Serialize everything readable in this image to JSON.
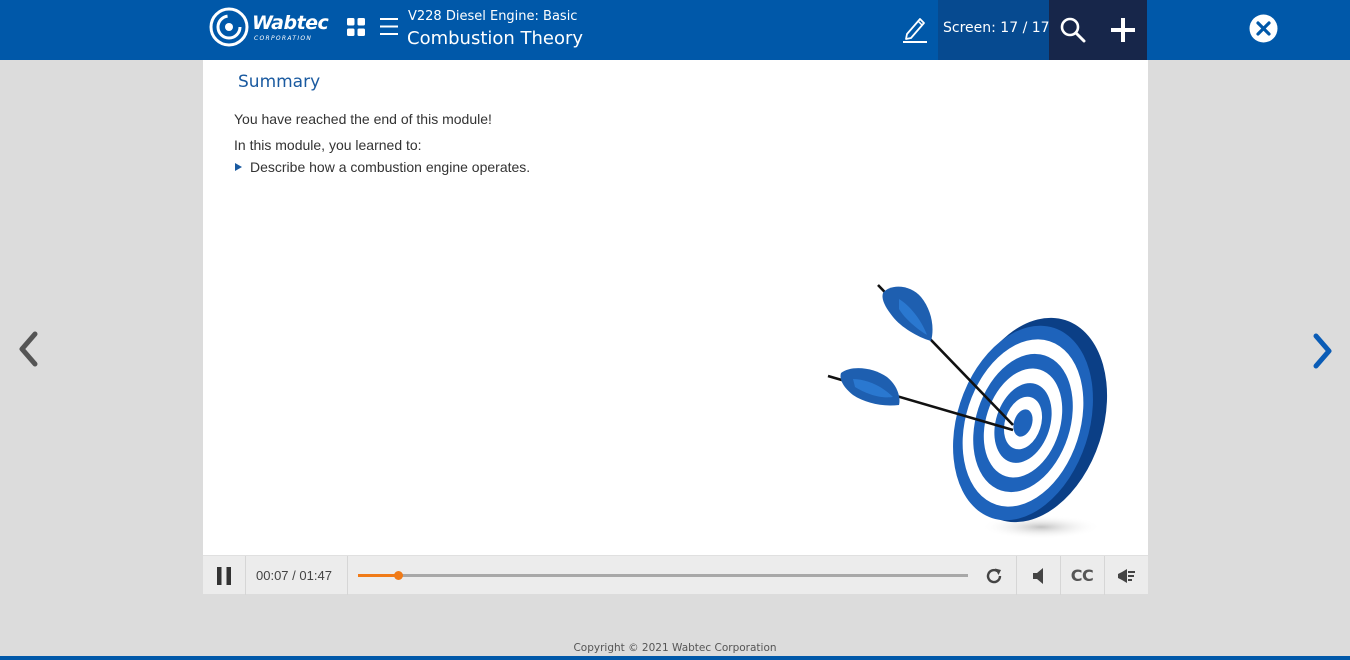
{
  "header": {
    "logo_text": "Wabtec",
    "logo_sub": "CORPORATION",
    "course_subtitle": "V228 Diesel Engine: Basic",
    "course_title": "Combustion Theory",
    "screen_counter": "Screen: 17 / 17",
    "icons": [
      "grid-icon",
      "menu-icon",
      "pencil-icon",
      "search-icon",
      "plus-icon",
      "close-icon"
    ],
    "colors": {
      "primary": "#0058a9",
      "dark": "#17264a",
      "screen_box": "#064a90"
    }
  },
  "content": {
    "title": "Summary",
    "line1": "You have reached the end of this module!",
    "line2": "In this module, you learned to:",
    "bullets": [
      "Describe how a combustion engine operates."
    ],
    "image": "target-with-arrows"
  },
  "player": {
    "current_time": "00:07",
    "total_time": "01:47",
    "time_display": "00:07 / 01:47",
    "progress_fraction": 0.065,
    "cc_label": "CC",
    "progress_color": "#f07b18",
    "icons": [
      "pause-icon",
      "replay-icon",
      "volume-icon",
      "cc-icon",
      "transcript-icon"
    ]
  },
  "nav": {
    "prev": "chevron-left-icon",
    "next": "chevron-right-icon"
  },
  "footer": {
    "copyright": "Copyright © 2021 Wabtec Corporation"
  }
}
